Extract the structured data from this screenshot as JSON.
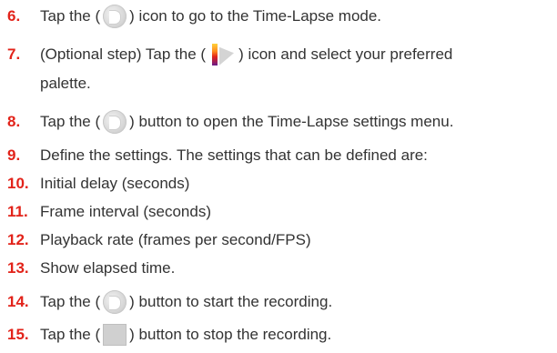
{
  "steps": [
    {
      "number": "6.",
      "before": "Tap the (",
      "icon": "time-lapse-icon",
      "after": ") icon to go to the Time-Lapse mode."
    },
    {
      "number": "7.",
      "before": "(Optional step) Tap the (",
      "icon": "palette-icon",
      "after": ") icon and select your preferred",
      "continuation": "palette."
    },
    {
      "number": "8.",
      "before": "Tap the (",
      "icon": "time-lapse-icon",
      "after": ") button to open the Time-Lapse settings menu."
    },
    {
      "number": "9.",
      "text": "Define the settings. The settings that can be defined are:"
    },
    {
      "number": "10.",
      "text": "Initial delay (seconds)"
    },
    {
      "number": "11.",
      "text": "Frame interval (seconds)"
    },
    {
      "number": "12.",
      "text": "Playback rate (frames per second/FPS)"
    },
    {
      "number": "13.",
      "text": "Show elapsed time."
    },
    {
      "number": "14.",
      "before": "Tap the (",
      "icon": "time-lapse-icon",
      "after": ") button to start the recording."
    },
    {
      "number": "15.",
      "before": "Tap the (",
      "icon": "stop-icon",
      "after": ") button to stop the recording."
    }
  ],
  "colors": {
    "number": "#e2231a",
    "text": "#333333"
  }
}
